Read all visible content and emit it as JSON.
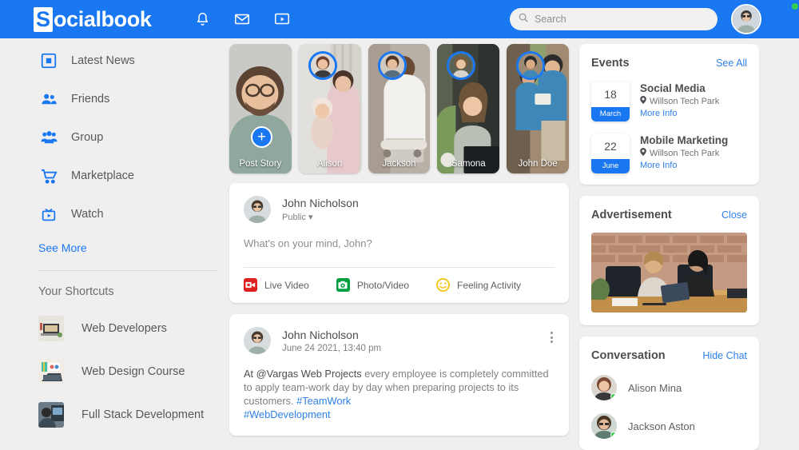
{
  "header": {
    "logo_initial": "S",
    "logo_rest": "ocialbook",
    "icons": [
      {
        "name": "bell-icon",
        "label": "Notifications"
      },
      {
        "name": "envelope-icon",
        "label": "Messages"
      },
      {
        "name": "video-icon",
        "label": "Watch"
      }
    ],
    "search": {
      "placeholder": "Search",
      "value": ""
    }
  },
  "sidebar": {
    "items": [
      {
        "label": "Latest News",
        "icon": "news-icon"
      },
      {
        "label": "Friends",
        "icon": "friends-icon"
      },
      {
        "label": "Group",
        "icon": "group-icon"
      },
      {
        "label": "Marketplace",
        "icon": "cart-icon"
      },
      {
        "label": "Watch",
        "icon": "tv-icon"
      }
    ],
    "see_more": "See More",
    "shortcuts_title": "Your Shortcuts",
    "shortcuts": [
      {
        "label": "Web Developers"
      },
      {
        "label": "Web Design Course"
      },
      {
        "label": "Full Stack Development"
      }
    ]
  },
  "stories": [
    {
      "name": "Post Story",
      "has_plus": true
    },
    {
      "name": "Alison",
      "has_plus": false
    },
    {
      "name": "Jackson",
      "has_plus": false
    },
    {
      "name": "Samona",
      "has_plus": false
    },
    {
      "name": "John Doe",
      "has_plus": false
    }
  ],
  "composer": {
    "author": "John Nicholson",
    "privacy": "Public",
    "placeholder": "What's on your mind, John?",
    "actions": [
      {
        "label": "Live Video",
        "icon": "live-video-icon",
        "color": "#e02020"
      },
      {
        "label": "Photo/Video",
        "icon": "photo-video-icon",
        "color": "#00a041"
      },
      {
        "label": "Feeling Activity",
        "icon": "feeling-icon",
        "color": "#f5c518"
      }
    ]
  },
  "post": {
    "author": "John Nicholson",
    "timestamp": "June 24 2021, 13:40 pm",
    "body_mention": "At @Vargas Web Projects",
    "body_text": " every employee is completely committed to apply team-work day by day when preparing projects to its customers. ",
    "tag1": "#TeamWork",
    "tag2": "#WebDevelopment"
  },
  "events": {
    "title": "Events",
    "see_all": "See All",
    "items": [
      {
        "day": "18",
        "month": "March",
        "title": "Social Media",
        "location": "Willson Tech Park",
        "more": "More Info"
      },
      {
        "day": "22",
        "month": "June",
        "title": "Mobile Marketing",
        "location": "Willson Tech Park",
        "more": "More Info"
      }
    ]
  },
  "advertisement": {
    "title": "Advertisement",
    "close": "Close"
  },
  "conversation": {
    "title": "Conversation",
    "hide": "Hide Chat",
    "contacts": [
      {
        "name": "Alison Mina",
        "online": true
      },
      {
        "name": "Jackson Aston",
        "online": true
      }
    ]
  },
  "colors": {
    "brand_blue": "#1a77f2",
    "link_blue": "#2c7fe8",
    "online_green": "#31d04f",
    "page_bg": "#efefef"
  }
}
